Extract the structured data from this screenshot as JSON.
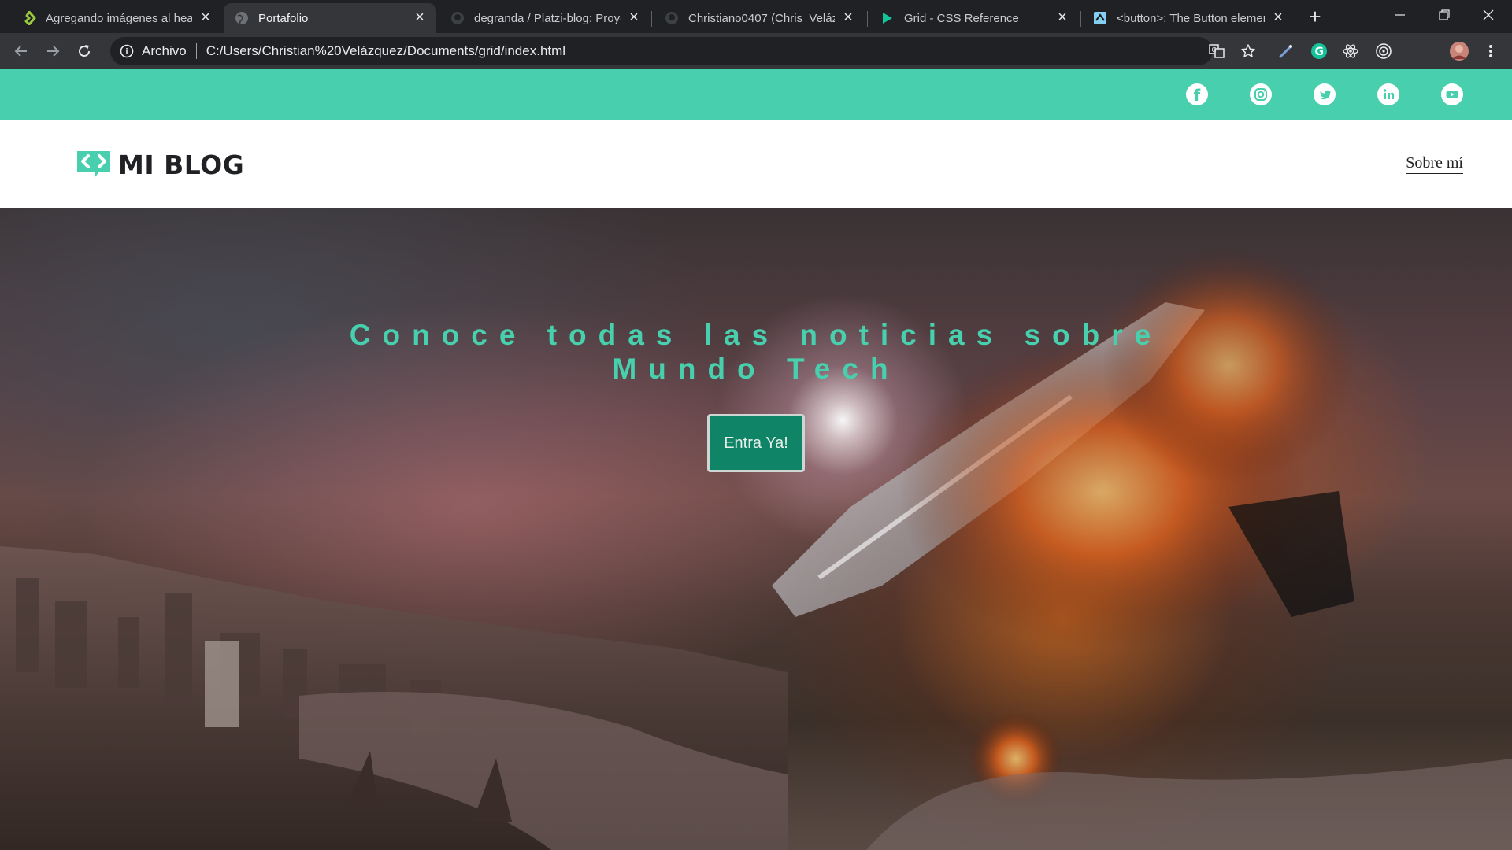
{
  "browser": {
    "tabs": [
      {
        "title": "Agregando imágenes al header",
        "icon": "platzi-icon",
        "active": false
      },
      {
        "title": "Portafolio",
        "icon": "globe-icon",
        "active": true
      },
      {
        "title": "degranda / Platzi-blog: Proyecto",
        "icon": "github-icon",
        "active": false
      },
      {
        "title": "Christiano0407 (Chris_Velázquez)",
        "icon": "github-icon",
        "active": false
      },
      {
        "title": "Grid - CSS Reference",
        "icon": "cssreference-icon",
        "active": false
      },
      {
        "title": "<button>: The Button element",
        "icon": "mdn-icon",
        "active": false
      }
    ],
    "address": {
      "scheme": "Archivo",
      "url": "C:/Users/Christian%20Velázquez/Documents/grid/index.html"
    },
    "colors": {
      "chrome_dark": "#202124",
      "chrome_toolbar": "#35363a",
      "grammarly": "#15c39a"
    }
  },
  "site": {
    "colors": {
      "accent": "#48cfad",
      "button": "#108467"
    },
    "social": [
      "facebook-icon",
      "instagram-icon",
      "twitter-icon",
      "linkedin-icon",
      "youtube-icon"
    ],
    "logo_text": "MI BLOG",
    "nav_about": "Sobre mí",
    "hero": {
      "title_line1": "Conoce todas las noticias sobre",
      "title_line2": "Mundo Tech",
      "cta": "Entra Ya!"
    }
  }
}
